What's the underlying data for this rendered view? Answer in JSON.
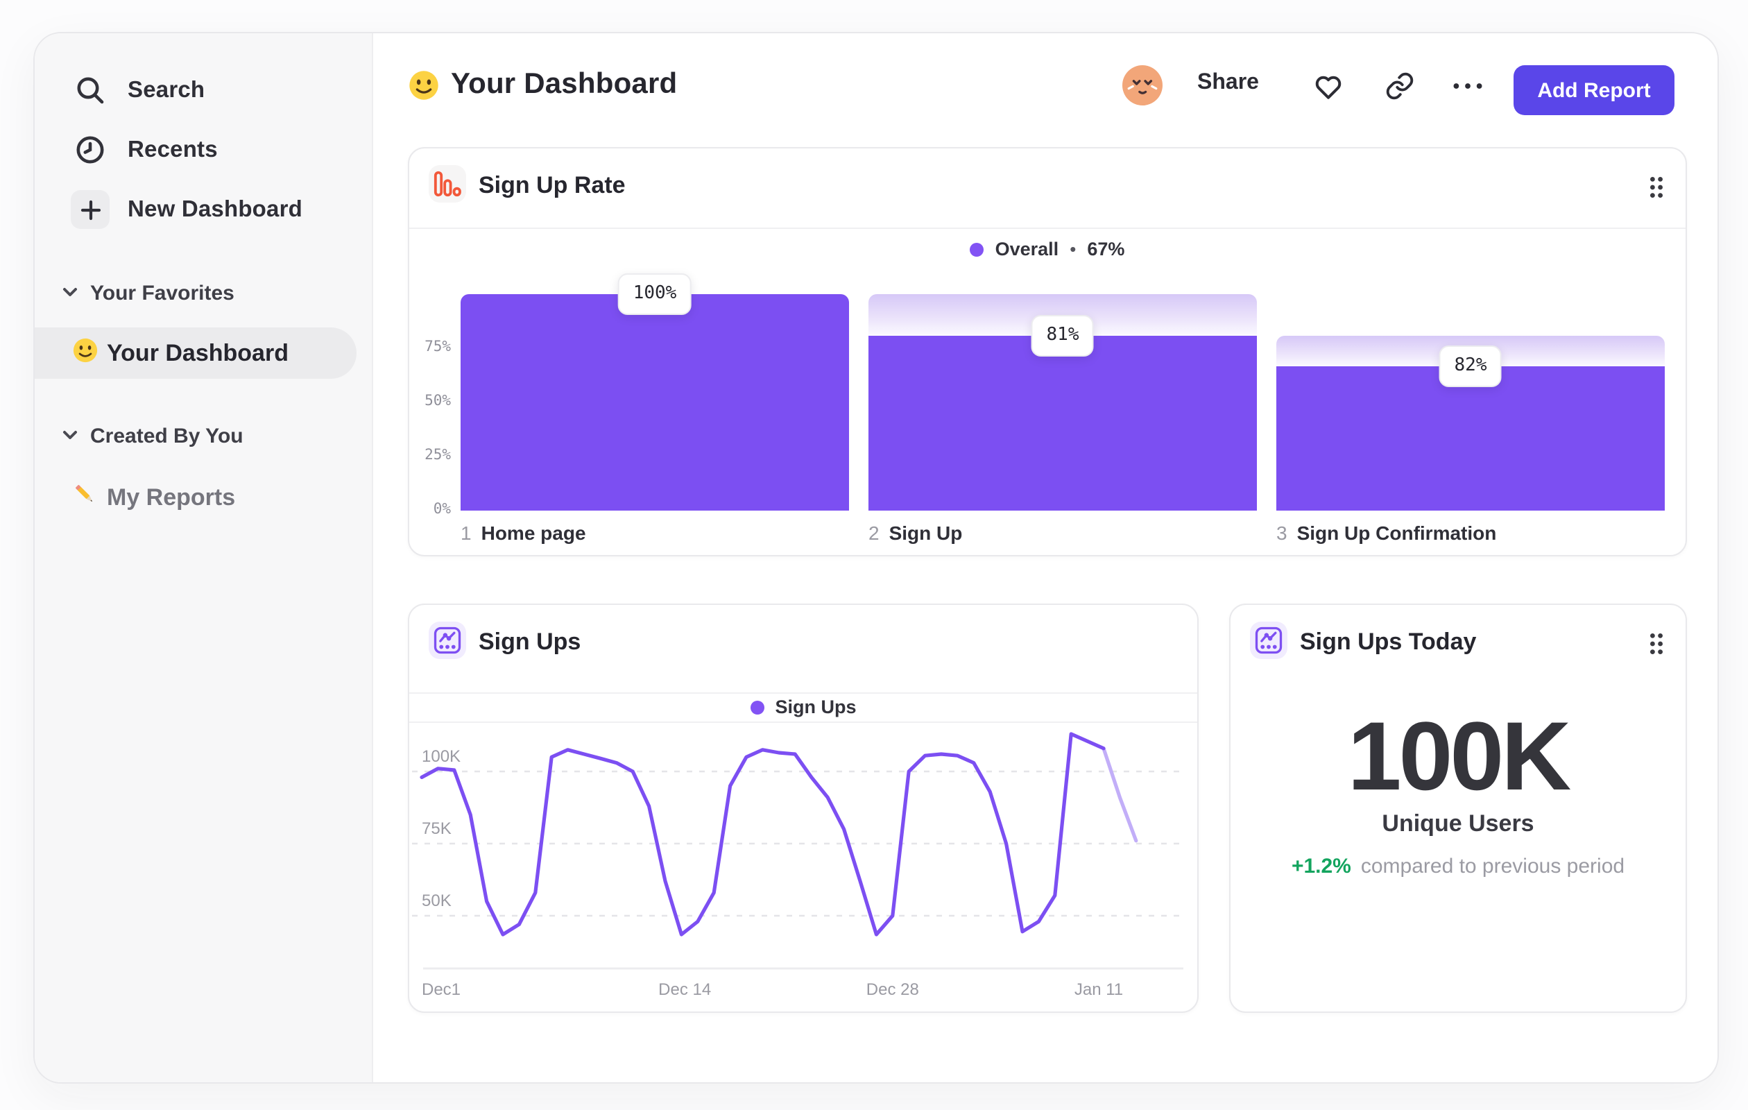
{
  "colors": {
    "accent_purple": "#7c4ff2",
    "accent_purple_light": "#c2aef8",
    "legend_dot": "#8253f4",
    "button_purple": "#5a46e9",
    "icon_orange": "#f2583a",
    "green": "#13a45e"
  },
  "sidebar": {
    "nav": [
      {
        "icon": "search-icon",
        "label": "Search"
      },
      {
        "icon": "recents-clock-icon",
        "label": "Recents"
      },
      {
        "icon": "plus-icon",
        "label": "New Dashboard"
      }
    ],
    "sections": [
      {
        "label": "Your Favorites",
        "item": {
          "emoji": "slightly-smiling-face",
          "label": "Your Dashboard",
          "active": true
        }
      },
      {
        "label": "Created By You",
        "item": {
          "emoji": "pencil",
          "label": "My Reports",
          "active": false
        }
      }
    ]
  },
  "header": {
    "emoji": "slightly-smiling-face",
    "title": "Your Dashboard",
    "share_label": "Share",
    "add_report_label": "Add Report"
  },
  "cards": {
    "funnel": {
      "title": "Sign Up Rate",
      "icon": "funnel-bars-icon",
      "legend": {
        "name": "Overall",
        "separator": "•",
        "value": "67%"
      }
    },
    "line": {
      "title": "Sign Ups",
      "icon": "insights-line-icon",
      "legend": {
        "name": "Sign Ups"
      }
    },
    "metric": {
      "title": "Sign Ups Today",
      "icon": "insights-line-icon",
      "value": "100K",
      "label": "Unique Users",
      "delta": "+1.2%",
      "delta_note": "compared to previous period"
    }
  },
  "chart_data": [
    {
      "type": "bar",
      "subtype": "funnel",
      "title": "Sign Up Rate",
      "series_name": "Overall",
      "overall_conversion": "67%",
      "categories": [
        "Home page",
        "Sign Up",
        "Sign Up Confirmation"
      ],
      "steps": [
        {
          "number": "1",
          "label": "Home page",
          "value_label": "100%",
          "conversion_from_previous": 100,
          "conversion_from_start": 100
        },
        {
          "number": "2",
          "label": "Sign Up",
          "value_label": "81%",
          "conversion_from_previous": 81,
          "conversion_from_start": 81
        },
        {
          "number": "3",
          "label": "Sign Up Confirmation",
          "value_label": "82%",
          "conversion_from_previous": 82,
          "conversion_from_start": 66.4
        }
      ],
      "y_ticks": [
        {
          "value": 0,
          "label": "0%"
        },
        {
          "value": 25,
          "label": "25%"
        },
        {
          "value": 50,
          "label": "50%"
        },
        {
          "value": 75,
          "label": "75%"
        }
      ],
      "ylim": [
        0,
        100
      ],
      "grid": false,
      "legend_position": "top-center"
    },
    {
      "type": "line",
      "title": "Sign Ups",
      "series": [
        {
          "name": "Sign Ups",
          "unit": "K",
          "values": [
            98,
            101,
            100.5,
            85,
            55,
            43.5,
            47,
            58,
            105,
            107.5,
            106,
            104.5,
            103,
            100,
            88,
            62,
            43.5,
            48,
            58,
            95,
            105,
            107.5,
            106.5,
            106,
            98,
            91,
            80,
            62,
            43.5,
            50,
            100,
            105.5,
            106,
            105.5,
            103,
            93,
            75,
            44.5,
            48,
            57,
            113,
            110.5,
            108,
            91,
            76
          ]
        }
      ],
      "incomplete_period_from_index": 42,
      "y_gridlines": [
        {
          "value": 100,
          "label": "100K"
        },
        {
          "value": 75,
          "label": "75K"
        },
        {
          "value": 50,
          "label": "50K"
        }
      ],
      "x_ticks": [
        {
          "label": "Dec1",
          "day": 0,
          "align": "left"
        },
        {
          "label": "Dec 14",
          "day": 16.2,
          "align": "center"
        },
        {
          "label": "Dec 28",
          "day": 29,
          "align": "center"
        },
        {
          "label": "Jan 11",
          "day": 41.7,
          "align": "center"
        }
      ],
      "days_total": 47,
      "ylim": [
        38,
        118
      ],
      "grid": "dashed-horizontal",
      "legend_position": "top-center"
    }
  ]
}
